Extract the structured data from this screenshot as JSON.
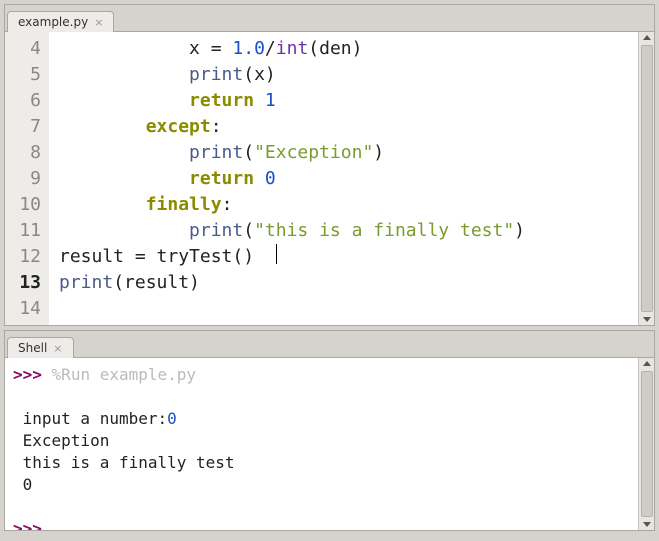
{
  "editor": {
    "tab_label": "example.py",
    "tab_close": "×",
    "gutter_start": 4,
    "gutter_end": 14,
    "current_line": 13,
    "code_lines": [
      {
        "n": 4,
        "indent": 12,
        "tokens": [
          [
            "id",
            "x = "
          ],
          [
            "num",
            "1.0"
          ],
          [
            "id",
            "/"
          ],
          [
            "builtin",
            "int"
          ],
          [
            "id",
            "(den)"
          ]
        ]
      },
      {
        "n": 5,
        "indent": 12,
        "tokens": [
          [
            "call",
            "print"
          ],
          [
            "id",
            "(x)"
          ]
        ]
      },
      {
        "n": 6,
        "indent": 12,
        "tokens": [
          [
            "kw",
            "return"
          ],
          [
            "id",
            " "
          ],
          [
            "num",
            "1"
          ]
        ]
      },
      {
        "n": 7,
        "indent": 8,
        "tokens": [
          [
            "kw",
            "except"
          ],
          [
            "id",
            ":"
          ]
        ]
      },
      {
        "n": 8,
        "indent": 12,
        "tokens": [
          [
            "call",
            "print"
          ],
          [
            "id",
            "("
          ],
          [
            "str",
            "\"Exception\""
          ],
          [
            "id",
            ")"
          ]
        ]
      },
      {
        "n": 9,
        "indent": 12,
        "tokens": [
          [
            "kw",
            "return"
          ],
          [
            "id",
            " "
          ],
          [
            "num",
            "0"
          ]
        ]
      },
      {
        "n": 10,
        "indent": 8,
        "tokens": [
          [
            "kw",
            "finally"
          ],
          [
            "id",
            ":"
          ]
        ]
      },
      {
        "n": 11,
        "indent": 12,
        "tokens": [
          [
            "call",
            "print"
          ],
          [
            "id",
            "("
          ],
          [
            "str",
            "\"this is a finally test\""
          ],
          [
            "id",
            ")"
          ]
        ]
      },
      {
        "n": 12,
        "indent": 0,
        "tokens": []
      },
      {
        "n": 13,
        "indent": 0,
        "tokens": [
          [
            "id",
            "result = tryTest()  "
          ],
          [
            "cursor",
            ""
          ]
        ]
      },
      {
        "n": 14,
        "indent": 0,
        "tokens": [
          [
            "call",
            "print"
          ],
          [
            "id",
            "(result)"
          ]
        ]
      }
    ]
  },
  "shell": {
    "tab_label": "Shell",
    "tab_close": "×",
    "prompt": ">>>",
    "run_cmd": "%Run example.py",
    "output_lines": [
      {
        "segments": [
          [
            "plain",
            " input a number:"
          ],
          [
            "num",
            "0"
          ]
        ]
      },
      {
        "segments": [
          [
            "plain",
            " Exception"
          ]
        ]
      },
      {
        "segments": [
          [
            "plain",
            " this is a finally test"
          ]
        ]
      },
      {
        "segments": [
          [
            "plain",
            " 0"
          ]
        ]
      }
    ]
  }
}
